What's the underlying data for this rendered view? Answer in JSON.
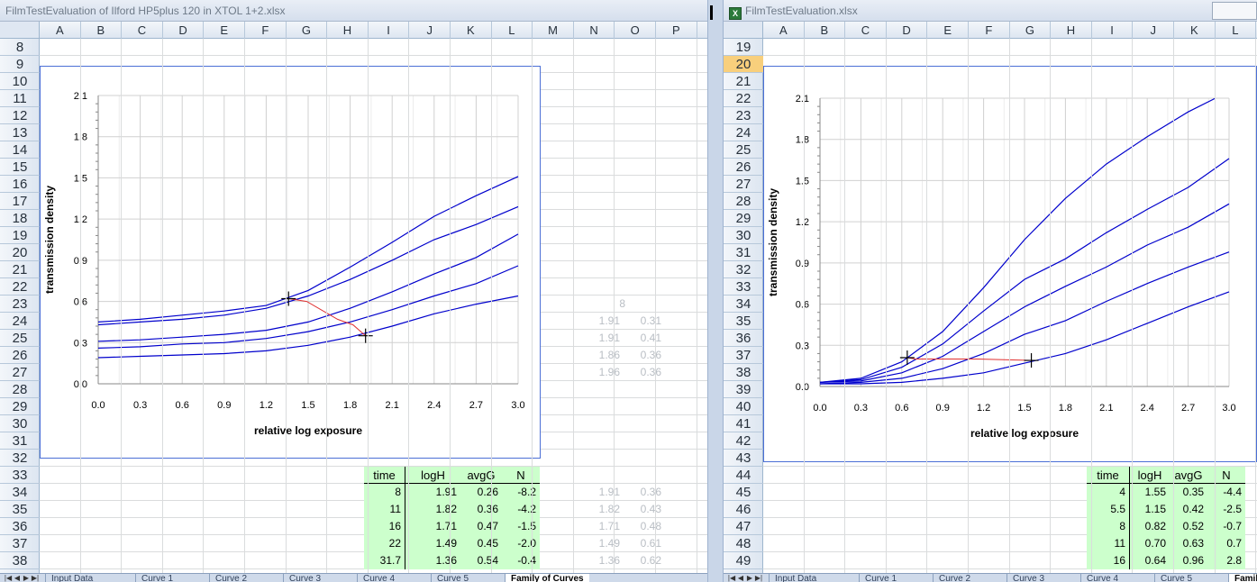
{
  "left_window": {
    "title": "FilmTestEvaluation of Ilford HP5plus 120 in XTOL 1+2.xlsx",
    "columns": [
      "A",
      "B",
      "C",
      "D",
      "E",
      "F",
      "G",
      "H",
      "I",
      "J",
      "K",
      "L",
      "M",
      "N",
      "O",
      "P"
    ],
    "rows": [
      "8",
      "9",
      "10",
      "11",
      "12",
      "13",
      "14",
      "15",
      "16",
      "17",
      "18",
      "19",
      "20",
      "21",
      "22",
      "23",
      "24",
      "25",
      "26",
      "27",
      "28",
      "29",
      "30",
      "31",
      "32",
      "33",
      "34",
      "35",
      "36",
      "37",
      "38"
    ],
    "table": {
      "headers": [
        "time",
        "logH",
        "avgG",
        "N"
      ],
      "rows": [
        [
          "8",
          "1.91",
          "0.26",
          "-8.2"
        ],
        [
          "11",
          "1.82",
          "0.36",
          "-4.2"
        ],
        [
          "16",
          "1.71",
          "0.47",
          "-1.5"
        ],
        [
          "22",
          "1.49",
          "0.45",
          "-2.0"
        ],
        [
          "31.7",
          "1.36",
          "0.54",
          "-0.4"
        ]
      ]
    },
    "faded_top": {
      "label": "8",
      "rows": [
        [
          "1.91",
          "0.31"
        ],
        [
          "1.91",
          "0.41"
        ],
        [
          "1.86",
          "0.36"
        ],
        [
          "1.96",
          "0.36"
        ]
      ]
    },
    "faded_bottom": [
      [
        "1.91",
        "0.36"
      ],
      [
        "1.82",
        "0.43"
      ],
      [
        "1.71",
        "0.48"
      ],
      [
        "1.49",
        "0.61"
      ],
      [
        "1.36",
        "0.62"
      ]
    ],
    "tabs": [
      "Input Data",
      "Curve 1",
      "Curve 2",
      "Curve 3",
      "Curve 4",
      "Curve 5",
      "Family of Curves"
    ]
  },
  "right_window": {
    "title": "FilmTestEvaluation.xlsx",
    "columns": [
      "A",
      "B",
      "C",
      "D",
      "E",
      "F",
      "G",
      "H",
      "I",
      "J",
      "K",
      "L"
    ],
    "rows": [
      "19",
      "20",
      "21",
      "22",
      "23",
      "24",
      "25",
      "26",
      "27",
      "28",
      "29",
      "30",
      "31",
      "32",
      "33",
      "34",
      "35",
      "36",
      "37",
      "38",
      "39",
      "40",
      "41",
      "42",
      "43",
      "44",
      "45",
      "46",
      "47",
      "48",
      "49"
    ],
    "selected_row": "20",
    "table": {
      "headers": [
        "time",
        "logH",
        "avgG",
        "N"
      ],
      "rows": [
        [
          "4",
          "1.55",
          "0.35",
          "-4.4"
        ],
        [
          "5.5",
          "1.15",
          "0.42",
          "-2.5"
        ],
        [
          "8",
          "0.82",
          "0.52",
          "-0.7"
        ],
        [
          "11",
          "0.70",
          "0.63",
          "0.7"
        ],
        [
          "16",
          "0.64",
          "0.96",
          "2.8"
        ]
      ]
    },
    "tabs": [
      "Input Data",
      "Curve 1",
      "Curve 2",
      "Curve 3",
      "Curve 4",
      "Curve 5",
      "Family of Curves"
    ]
  },
  "chart_data": [
    {
      "type": "line",
      "title": "",
      "xlabel": "relative log exposure",
      "ylabel": "transmission density",
      "xlim": [
        0,
        3.0
      ],
      "ylim": [
        0,
        2.1
      ],
      "xticks": [
        "0.0",
        "0.3",
        "0.6",
        "0.9",
        "1.2",
        "1.5",
        "1.8",
        "2.1",
        "2.4",
        "2.7",
        "3.0"
      ],
      "yticks": [
        "0.0",
        "0.3",
        "0.6",
        "0.9",
        "1.2",
        "1.5",
        "1.8",
        "2.1"
      ],
      "grid": true,
      "series_color": "#0000cc",
      "series": [
        {
          "x": [
            0,
            0.3,
            0.6,
            0.9,
            1.2,
            1.5,
            1.8,
            2.1,
            2.4,
            2.7,
            3.0
          ],
          "y": [
            0.45,
            0.47,
            0.5,
            0.53,
            0.57,
            0.68,
            0.85,
            1.03,
            1.22,
            1.37,
            1.51
          ]
        },
        {
          "x": [
            0,
            0.3,
            0.6,
            0.9,
            1.2,
            1.5,
            1.8,
            2.1,
            2.4,
            2.7,
            3.0
          ],
          "y": [
            0.43,
            0.45,
            0.47,
            0.5,
            0.55,
            0.64,
            0.76,
            0.9,
            1.05,
            1.16,
            1.29
          ]
        },
        {
          "x": [
            0,
            0.3,
            0.6,
            0.9,
            1.2,
            1.5,
            1.8,
            2.1,
            2.4,
            2.7,
            3.0
          ],
          "y": [
            0.31,
            0.32,
            0.34,
            0.36,
            0.39,
            0.45,
            0.55,
            0.67,
            0.8,
            0.92,
            1.09
          ]
        },
        {
          "x": [
            0,
            0.3,
            0.6,
            0.9,
            1.2,
            1.5,
            1.8,
            2.1,
            2.4,
            2.7,
            3.0
          ],
          "y": [
            0.26,
            0.27,
            0.29,
            0.3,
            0.33,
            0.38,
            0.45,
            0.54,
            0.64,
            0.73,
            0.86
          ]
        },
        {
          "x": [
            0,
            0.3,
            0.6,
            0.9,
            1.2,
            1.5,
            1.8,
            2.1,
            2.4,
            2.7,
            3.0
          ],
          "y": [
            0.19,
            0.2,
            0.21,
            0.22,
            0.24,
            0.28,
            0.34,
            0.42,
            0.51,
            0.58,
            0.64
          ]
        }
      ],
      "marker_line_color": "#e03030",
      "marker_line": {
        "x": [
          1.36,
          1.49,
          1.71,
          1.82,
          1.91
        ],
        "y": [
          0.62,
          0.6,
          0.47,
          0.43,
          0.35
        ]
      },
      "crosshair_points": [
        {
          "x": 1.36,
          "y": 0.62
        },
        {
          "x": 1.91,
          "y": 0.35
        }
      ]
    },
    {
      "type": "line",
      "title": "",
      "xlabel": "relative log exposure",
      "ylabel": "transmission density",
      "xlim": [
        0,
        3.0
      ],
      "ylim": [
        0,
        2.1
      ],
      "xticks": [
        "0.0",
        "0.3",
        "0.6",
        "0.9",
        "1.2",
        "1.5",
        "1.8",
        "2.1",
        "2.4",
        "2.7",
        "3.0"
      ],
      "yticks": [
        "0.0",
        "0.3",
        "0.6",
        "0.9",
        "1.2",
        "1.5",
        "1.8",
        "2.1"
      ],
      "grid": true,
      "series_color": "#0000cc",
      "series": [
        {
          "x": [
            0,
            0.3,
            0.6,
            0.9,
            1.2,
            1.5,
            1.8,
            2.1,
            2.4,
            2.7,
            2.9
          ],
          "y": [
            0.03,
            0.06,
            0.18,
            0.4,
            0.72,
            1.07,
            1.37,
            1.62,
            1.82,
            2.0,
            2.1
          ]
        },
        {
          "x": [
            0,
            0.3,
            0.6,
            0.9,
            1.2,
            1.5,
            1.8,
            2.1,
            2.4,
            2.7,
            3.0
          ],
          "y": [
            0.03,
            0.05,
            0.14,
            0.31,
            0.55,
            0.78,
            0.93,
            1.12,
            1.29,
            1.45,
            1.66
          ]
        },
        {
          "x": [
            0,
            0.3,
            0.6,
            0.9,
            1.2,
            1.5,
            1.8,
            2.1,
            2.4,
            2.7,
            3.0
          ],
          "y": [
            0.03,
            0.04,
            0.1,
            0.22,
            0.4,
            0.58,
            0.73,
            0.87,
            1.03,
            1.16,
            1.33
          ]
        },
        {
          "x": [
            0,
            0.3,
            0.6,
            0.9,
            1.2,
            1.5,
            1.8,
            2.1,
            2.4,
            2.7,
            3.0
          ],
          "y": [
            0.02,
            0.03,
            0.06,
            0.13,
            0.24,
            0.38,
            0.48,
            0.62,
            0.75,
            0.87,
            0.98
          ]
        },
        {
          "x": [
            0,
            0.3,
            0.6,
            0.9,
            1.2,
            1.5,
            1.8,
            2.1,
            2.4,
            2.7,
            3.0
          ],
          "y": [
            0.02,
            0.02,
            0.03,
            0.06,
            0.1,
            0.17,
            0.24,
            0.34,
            0.46,
            0.58,
            0.69
          ]
        }
      ],
      "marker_line_color": "#e03030",
      "marker_line": {
        "x": [
          0.64,
          0.7,
          0.82,
          1.15,
          1.55
        ],
        "y": [
          0.21,
          0.2,
          0.2,
          0.2,
          0.19
        ]
      },
      "crosshair_points": [
        {
          "x": 0.64,
          "y": 0.21
        },
        {
          "x": 1.55,
          "y": 0.19
        }
      ]
    }
  ]
}
